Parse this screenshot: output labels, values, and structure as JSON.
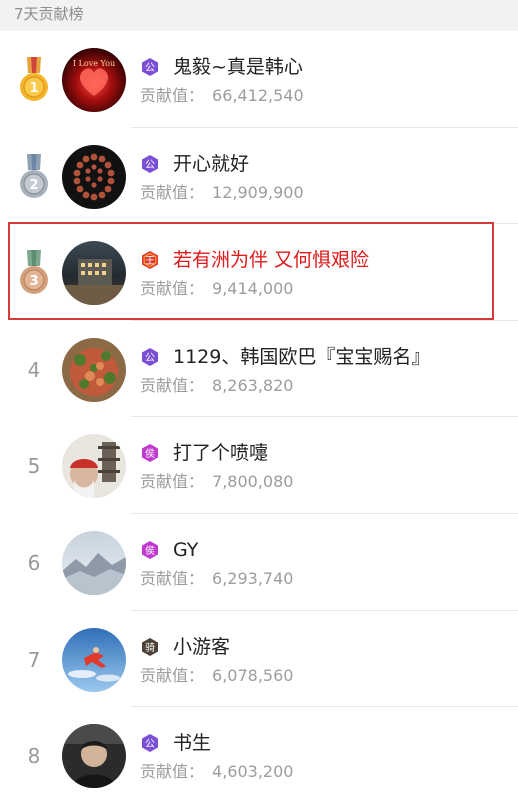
{
  "header": {
    "title": "7天贡献榜"
  },
  "labels": {
    "contribution_prefix": "贡献值："
  },
  "colors": {
    "gold": "#f3b52a",
    "silver": "#a9b1bb",
    "bronze": "#d4a07e",
    "badge_purple": "#7a4fd6",
    "badge_red": "#e0392c",
    "badge_magenta": "#c03ad0",
    "badge_brown": "#4d4036",
    "highlight": "#e01b1b"
  },
  "entries": [
    {
      "rank": "1",
      "medal": "gold",
      "badge": {
        "icon": "purple-hexagon-badge",
        "char": "公"
      },
      "name": "鬼毅~真是韩心",
      "value": "66,412,540"
    },
    {
      "rank": "2",
      "medal": "silver",
      "badge": {
        "icon": "purple-hexagon-badge",
        "char": "公"
      },
      "name": "开心就好",
      "value": "12,909,900"
    },
    {
      "rank": "3",
      "medal": "bronze",
      "badge": {
        "icon": "red-hexagon-badge",
        "char": "王"
      },
      "name": "若有洲为伴 又何惧艰险",
      "value": "9,414,000",
      "highlighted": true
    },
    {
      "rank": "4",
      "badge": {
        "icon": "purple-hexagon-badge",
        "char": "公"
      },
      "name": "1129、韩国欧巴『宝宝赐名』",
      "value": "8,263,820"
    },
    {
      "rank": "5",
      "badge": {
        "icon": "magenta-hexagon-badge",
        "char": "侯"
      },
      "name": "打了个喷嚏",
      "value": "7,800,080"
    },
    {
      "rank": "6",
      "badge": {
        "icon": "magenta-hexagon-badge",
        "char": "侯"
      },
      "name": "GY",
      "value": "6,293,740"
    },
    {
      "rank": "7",
      "badge": {
        "icon": "brown-hexagon-badge",
        "char": "骑"
      },
      "name": "小游客",
      "value": "6,078,560"
    },
    {
      "rank": "8",
      "badge": {
        "icon": "purple-hexagon-badge",
        "char": "公"
      },
      "name": "书生",
      "value": "4,603,200"
    }
  ]
}
